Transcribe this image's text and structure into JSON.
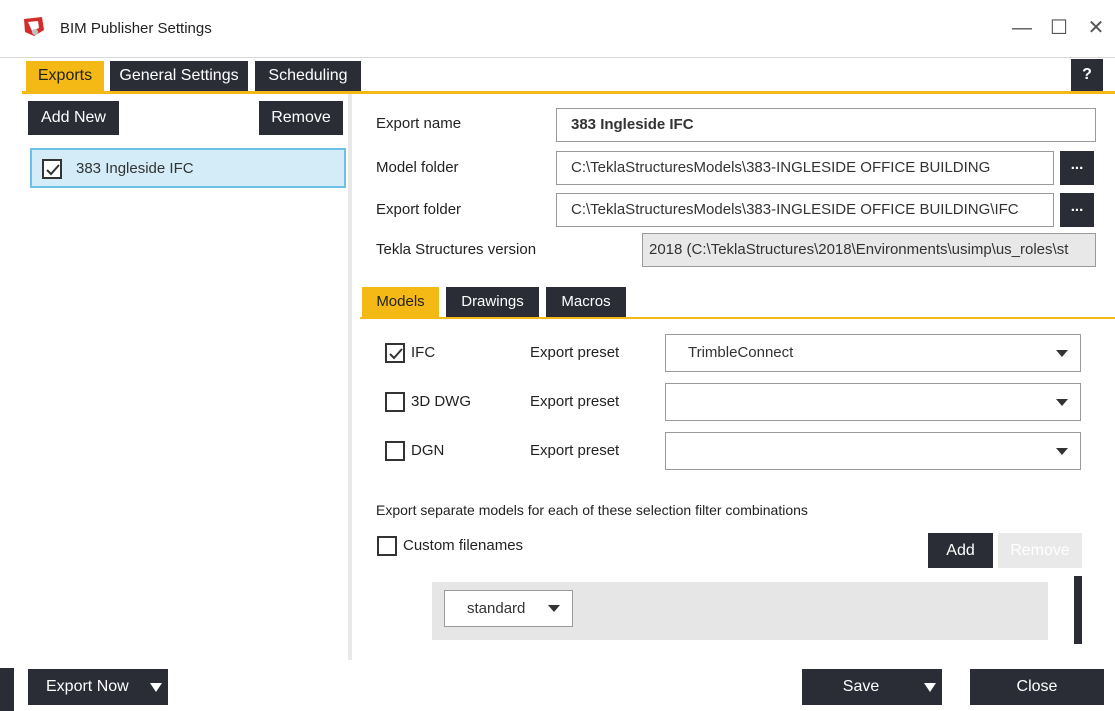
{
  "window": {
    "title": "BIM Publisher Settings",
    "minimize": "—",
    "maximize": "☐",
    "close": "✕"
  },
  "top_tabs": [
    "Exports",
    "General Settings",
    "Scheduling"
  ],
  "help_label": "?",
  "left": {
    "add_new": "Add New",
    "remove": "Remove",
    "exports": [
      {
        "name": "383 Ingleside IFC",
        "checked": true
      }
    ]
  },
  "form": {
    "export_name_label": "Export name",
    "export_name_value": "383 Ingleside IFC",
    "model_folder_label": "Model folder",
    "model_folder_value": "C:\\TeklaStructuresModels\\383-INGLESIDE OFFICE BUILDING",
    "export_folder_label": "Export folder",
    "export_folder_value": "C:\\TeklaStructuresModels\\383-INGLESIDE OFFICE BUILDING\\IFC",
    "version_label": "Tekla Structures version",
    "version_value": "2018 (C:\\TeklaStructures\\2018\\Environments\\usimp\\us_roles\\st",
    "browse_label": "..."
  },
  "sub_tabs": [
    "Models",
    "Drawings",
    "Macros"
  ],
  "models": {
    "rows": [
      {
        "name": "IFC",
        "checked": true,
        "preset_label": "Export preset",
        "preset_value": "TrimbleConnect"
      },
      {
        "name": "3D DWG",
        "checked": false,
        "preset_label": "Export preset",
        "preset_value": ""
      },
      {
        "name": "DGN",
        "checked": false,
        "preset_label": "Export preset",
        "preset_value": ""
      }
    ],
    "filter_heading": "Export separate models for each of these selection filter combinations",
    "custom_filenames": "Custom filenames",
    "add": "Add",
    "remove": "Remove",
    "filter_value": "standard"
  },
  "footer": {
    "export_now": "Export Now",
    "save": "Save",
    "close": "Close"
  },
  "colors": {
    "accent": "#f5b915",
    "dark": "#2a2d36",
    "selection": "#d3ecf7"
  }
}
